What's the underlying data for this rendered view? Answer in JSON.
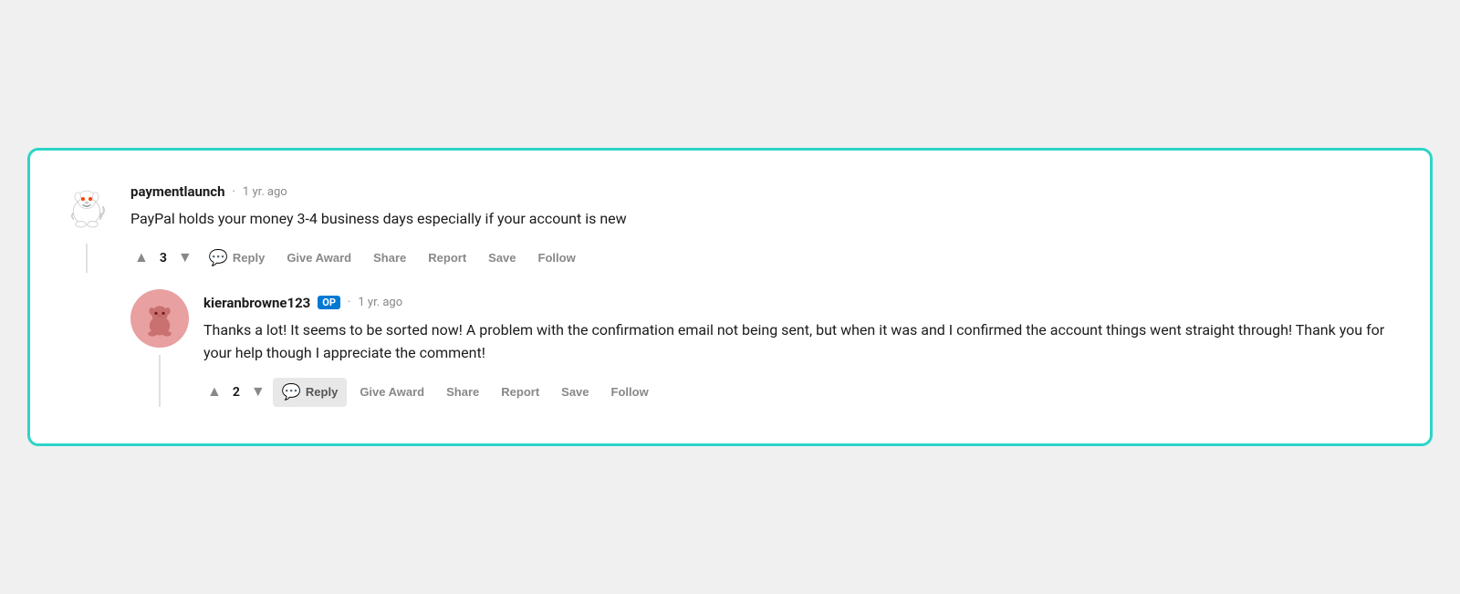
{
  "comment1": {
    "username": "paymentlaunch",
    "timestamp": "1 yr. ago",
    "text": "PayPal holds your money 3-4 business days especially if your account is new",
    "vote_count": "3",
    "actions": {
      "reply": "Reply",
      "give_award": "Give Award",
      "share": "Share",
      "report": "Report",
      "save": "Save",
      "follow": "Follow"
    }
  },
  "comment2": {
    "username": "kieranbrowne123",
    "op_badge": "OP",
    "timestamp": "1 yr. ago",
    "text": "Thanks a lot! It seems to be sorted now! A problem with the confirmation email not being sent, but when it was and I confirmed the account things went straight through! Thank you for your help though I appreciate the comment!",
    "vote_count": "2",
    "actions": {
      "reply": "Reply",
      "give_award": "Give Award",
      "share": "Share",
      "report": "Report",
      "save": "Save",
      "follow": "Follow"
    }
  },
  "separators": {
    "dot": "·"
  }
}
